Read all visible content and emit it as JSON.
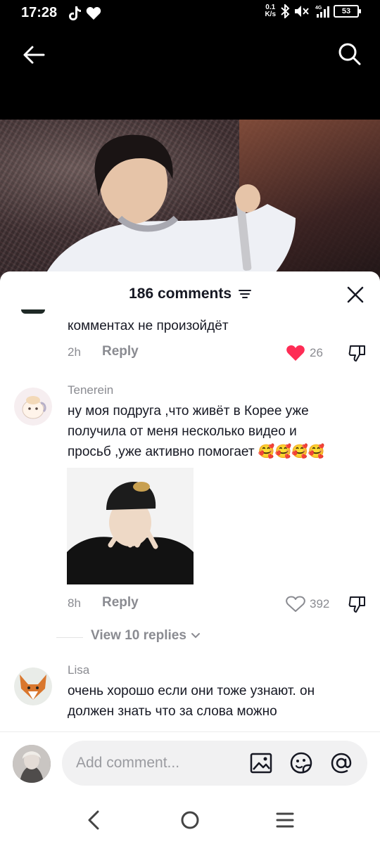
{
  "status_bar": {
    "time": "17:28",
    "speed_top": "0.1",
    "speed_bottom": "K/s",
    "network": "4G",
    "battery": "53"
  },
  "sheet": {
    "title": "186 comments"
  },
  "comments": [
    {
      "text": "комментах не произойдёт",
      "time": "2h",
      "reply_label": "Reply",
      "likes": "26",
      "liked": true
    },
    {
      "username": "Tenerein",
      "text_lines": [
        "ну моя подруга ,что живёт в Корее уже",
        "получила от меня несколько видео и",
        "просьб ,уже активно помогает 🥰🥰🥰🥰"
      ],
      "time": "8h",
      "reply_label": "Reply",
      "likes": "392",
      "liked": false,
      "view_replies": "View 10 replies"
    },
    {
      "username": "Lisa",
      "text_lines": [
        "очень хорошо если они тоже узнают. он",
        "должен знать что за слова можно"
      ]
    }
  ],
  "input": {
    "placeholder": "Add comment..."
  },
  "colors": {
    "like_active": "#fe2c55",
    "muted": "#8a8b91",
    "text": "#161823"
  }
}
